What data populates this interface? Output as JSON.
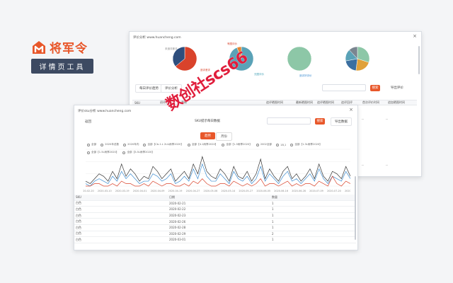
{
  "brand": {
    "name": "将军令",
    "tagline": "详情页工具",
    "accent": "#e8572a"
  },
  "back_window": {
    "title": "评价分析 www.huancheng.com",
    "close": "×",
    "pies": [
      {
        "labels": [
          "未追评差评",
          "追评差评"
        ],
        "slices": [
          {
            "value": 64,
            "color": "#d9432b"
          },
          {
            "value": 36,
            "color": "#2e4e7d"
          }
        ]
      },
      {
        "labels": [
          "有图评价",
          "无图评价"
        ],
        "slices": [
          {
            "value": 94,
            "color": "#5aa2b7"
          },
          {
            "value": 6,
            "color": "#e8842f"
          }
        ]
      },
      {
        "labels": [
          "追评好评价"
        ],
        "slices": [
          {
            "value": 100,
            "color": "#8dc7a7"
          }
        ]
      },
      {
        "labels": [],
        "slices": [
          {
            "value": 30,
            "color": "#8dc7a7"
          },
          {
            "value": 22,
            "color": "#e0a13a"
          },
          {
            "value": 20,
            "color": "#3b6fa0"
          },
          {
            "value": 16,
            "color": "#5aa2b7"
          },
          {
            "value": 12,
            "color": "#7a8590"
          }
        ]
      }
    ],
    "toolbar": {
      "btn1": "每日评价趋势",
      "btn2": "评价分析",
      "search_btn": "搜索",
      "export": "导出评价"
    },
    "columns": [
      "SKU",
      "初评日期",
      "最新",
      "追评晒图时间",
      "最新晒图时间",
      "追评晒图时间",
      "追评回评",
      "首次评价时间",
      "追加晒图时间"
    ],
    "empty_cells": [
      "--",
      "--",
      "--",
      "--"
    ]
  },
  "front_window": {
    "title": "评价sku分析 www.huancheng.com",
    "close": "×",
    "back_link": "返回",
    "frame_title": "SKU提示每日数据",
    "search_btn": "搜索",
    "export": "导出数据",
    "tabs": [
      "趋势",
      "月份"
    ],
    "legend": [
      "全部",
      "2020年总数",
      "2020年内",
      "全部【Cb-1.L 2L&雨季2020】",
      "全部【4.1雨季2020】",
      "全部【1.5雨季2020】",
      "2002全部",
      "1B,1",
      "全部【1.3L雨季2020】",
      "全部【1.5L雨季2020】",
      "全部【3.5L雨季2020】"
    ],
    "x_labels": [
      "2020-02-20",
      "2020-03-10",
      "2020-03-19",
      "2020-04-01",
      "2020-04-09",
      "2020-04-19",
      "2020-04-27",
      "2020-05-06",
      "2020-05-14",
      "2020-05-27",
      "2020-06-05",
      "2020-06-16",
      "2020-06-28",
      "2020-07-09",
      "2020-07-20",
      "2020-08-01"
    ],
    "table": {
      "headers": [
        "SKU",
        "日期",
        "数量"
      ],
      "rows": [
        [
          "白色",
          "2020-02-21",
          "1"
        ],
        [
          "白色",
          "2020-02-22",
          "1"
        ],
        [
          "白色",
          "2020-02-23",
          "1"
        ],
        [
          "白色",
          "2020-02-26",
          "1"
        ],
        [
          "白色",
          "2020-02-28",
          "1"
        ],
        [
          "白色",
          "2020-02-29",
          "2"
        ],
        [
          "白色",
          "2020-03-01",
          "1"
        ]
      ]
    }
  },
  "chart_data": {
    "type": "line",
    "x": [
      "2020-02-20",
      "2020-03-10",
      "2020-03-19",
      "2020-04-01",
      "2020-04-09",
      "2020-04-19",
      "2020-04-27",
      "2020-05-06",
      "2020-05-14",
      "2020-05-27",
      "2020-06-05",
      "2020-06-16",
      "2020-06-28",
      "2020-07-09",
      "2020-07-20",
      "2020-08-01"
    ],
    "ylim": [
      0,
      15
    ],
    "series": [
      {
        "color": "#333333",
        "values": [
          2,
          1,
          3,
          5,
          4,
          2,
          6,
          3,
          9,
          4,
          7,
          5,
          2,
          4,
          3,
          8,
          6,
          3,
          5,
          7,
          2,
          4,
          6,
          3,
          9,
          5,
          12,
          6,
          4,
          3,
          7,
          5,
          2,
          8,
          4,
          3,
          6,
          2,
          5,
          11,
          3,
          7,
          4,
          2,
          6,
          8,
          3,
          5,
          2,
          4,
          7,
          3,
          9,
          4,
          2,
          6,
          5,
          3,
          8,
          4
        ]
      },
      {
        "color": "#3b8cd1",
        "values": [
          1,
          0,
          2,
          3,
          2,
          1,
          4,
          2,
          6,
          3,
          5,
          3,
          1,
          2,
          2,
          5,
          4,
          2,
          3,
          5,
          1,
          2,
          4,
          2,
          7,
          3,
          9,
          4,
          2,
          2,
          5,
          3,
          1,
          6,
          3,
          2,
          4,
          1,
          3,
          8,
          2,
          5,
          3,
          1,
          4,
          6,
          2,
          3,
          1,
          3,
          5,
          2,
          7,
          3,
          1,
          4,
          3,
          2,
          6,
          3
        ]
      },
      {
        "color": "#d9432b",
        "values": [
          0,
          0,
          1,
          1,
          0,
          0,
          1,
          0,
          2,
          1,
          1,
          0,
          0,
          1,
          0,
          2,
          1,
          0,
          1,
          1,
          0,
          0,
          1,
          0,
          2,
          1,
          3,
          1,
          0,
          0,
          1,
          1,
          0,
          2,
          1,
          0,
          1,
          0,
          1,
          3,
          0,
          1,
          1,
          0,
          1,
          2,
          0,
          1,
          0,
          1,
          1,
          0,
          2,
          1,
          0,
          4,
          1,
          0,
          2,
          1
        ]
      }
    ]
  }
}
